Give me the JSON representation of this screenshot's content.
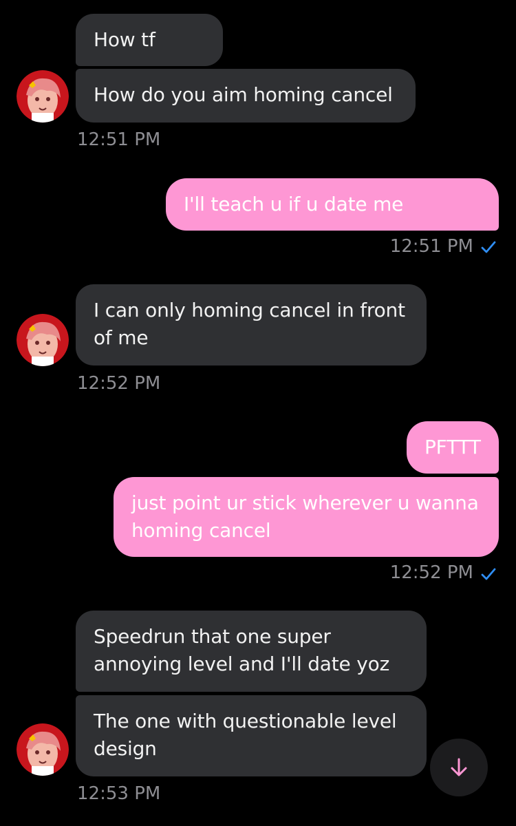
{
  "messages": [
    {
      "side": "in",
      "text": "How tf"
    },
    {
      "side": "in",
      "text": "How do you aim homing cancel"
    },
    {
      "side": "in_time",
      "text": "12:51 PM"
    },
    {
      "side": "out",
      "text": "I'll teach u if u date me"
    },
    {
      "side": "out_time",
      "text": "12:51 PM"
    },
    {
      "side": "in",
      "text": "I can only homing cancel in front of me"
    },
    {
      "side": "in_time",
      "text": "12:52 PM"
    },
    {
      "side": "out",
      "text": "PFTTT"
    },
    {
      "side": "out",
      "text": "just point ur stick wherever u wanna homing cancel"
    },
    {
      "side": "out_time",
      "text": "12:52 PM"
    },
    {
      "side": "in",
      "text": "Speedrun that one super annoying level and I'll date yoz"
    },
    {
      "side": "in",
      "text": "The one with questionable level design"
    },
    {
      "side": "in_time",
      "text": "12:53 PM"
    }
  ],
  "icons": {
    "read_receipt": "check-icon",
    "scroll_button": "arrow-down-icon",
    "avatar": "contact-avatar"
  },
  "colors": {
    "background": "#000000",
    "incoming_bubble": "#2f3033",
    "outgoing_bubble": "#fe97d4",
    "timestamp": "#8e8e93",
    "read_check": "#2f8ef4",
    "accent": "#fe97d4"
  }
}
